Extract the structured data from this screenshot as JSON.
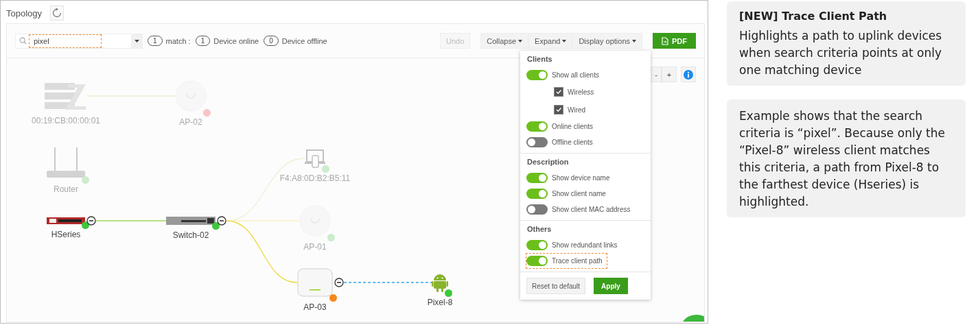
{
  "page": {
    "title": "Topology"
  },
  "toolbar": {
    "search": {
      "value": "pixel",
      "highlighted": true
    },
    "counters": [
      {
        "count": "1",
        "label": "match :"
      },
      {
        "count": "1",
        "label": "Device online"
      },
      {
        "count": "0",
        "label": "Device offline"
      }
    ],
    "buttons": [
      {
        "label": "Undo",
        "kind": "plain",
        "disabled": true
      },
      {
        "label": "Collapse",
        "kind": "dropdown",
        "disabled": false
      },
      {
        "label": "Expand",
        "kind": "dropdown",
        "disabled": false
      },
      {
        "label": "Display options",
        "kind": "dropdown",
        "disabled": false
      },
      {
        "label": "PDF",
        "kind": "primary",
        "disabled": false
      }
    ]
  },
  "zoom_controls": [
    "-",
    "+"
  ],
  "display_menu": {
    "sections": [
      {
        "title": "Clients",
        "items": [
          {
            "kind": "toggle",
            "label": "Show all clients",
            "on": true,
            "highlighted": false
          },
          {
            "kind": "checkbox",
            "label": "Wireless",
            "on": true,
            "highlighted": false
          },
          {
            "kind": "checkbox",
            "label": "Wired",
            "on": true,
            "highlighted": false
          },
          {
            "kind": "toggle",
            "label": "Online clients",
            "on": true,
            "highlighted": false
          },
          {
            "kind": "toggle",
            "label": "Offline clients",
            "on": false,
            "highlighted": false
          }
        ]
      },
      {
        "title": "Description",
        "items": [
          {
            "kind": "toggle",
            "label": "Show device name",
            "on": true,
            "highlighted": false
          },
          {
            "kind": "toggle",
            "label": "Show client name",
            "on": true,
            "highlighted": false
          },
          {
            "kind": "toggle",
            "label": "Show client MAC address",
            "on": false,
            "highlighted": false
          }
        ]
      },
      {
        "title": "Others",
        "items": [
          {
            "kind": "toggle",
            "label": "Show redundant links",
            "on": true,
            "highlighted": false
          },
          {
            "kind": "toggle",
            "label": "Trace client path",
            "on": true,
            "highlighted": true
          }
        ]
      }
    ],
    "buttons": [
      {
        "label": "Reset to default",
        "kind": "plain"
      },
      {
        "label": "Apply",
        "kind": "primary"
      }
    ]
  },
  "topology": {
    "nodes": [
      {
        "label": "00:19:CB:00:00:01",
        "kind": "server",
        "dimmed": true,
        "collapsible": false
      },
      {
        "label": "AP-02",
        "kind": "ap",
        "dimmed": true,
        "collapsible": false,
        "color": "#f8c4c8"
      },
      {
        "label": "Router",
        "kind": "router",
        "dimmed": true,
        "collapsible": false,
        "color": "#cdeccd"
      },
      {
        "label": "F4:A8:0D:B2:B5:11",
        "kind": "laptop",
        "dimmed": true,
        "collapsible": false,
        "color": "#cdeccd"
      },
      {
        "label": "HSeries",
        "kind": "firewall",
        "dimmed": false,
        "collapsible": true,
        "color": "#3cc83c"
      },
      {
        "label": "Switch-02",
        "kind": "switch",
        "dimmed": false,
        "collapsible": true,
        "color": "#3cc83c"
      },
      {
        "label": "AP-01",
        "kind": "ap",
        "dimmed": true,
        "collapsible": false,
        "color": "#cdeccd"
      },
      {
        "label": "AP-03",
        "kind": "ap-box",
        "dimmed": false,
        "collapsible": true,
        "color": "#f5891a"
      },
      {
        "label": "Pixel-8",
        "kind": "android",
        "dimmed": false,
        "collapsible": false,
        "color": "#3cc83c"
      }
    ],
    "has_links": true
  },
  "notes": [
    {
      "title": "[NEW] Trace Client Path",
      "text": "Highlights a path to uplink devices when search criteria points at only one matching device"
    },
    {
      "text": "Example shows that the search criteria is “pixel”. Because only the “Pixel-8” wireless client matches this criteria, a path from Pixel-8 to the farthest device (Hseries) is highlighted."
    }
  ]
}
